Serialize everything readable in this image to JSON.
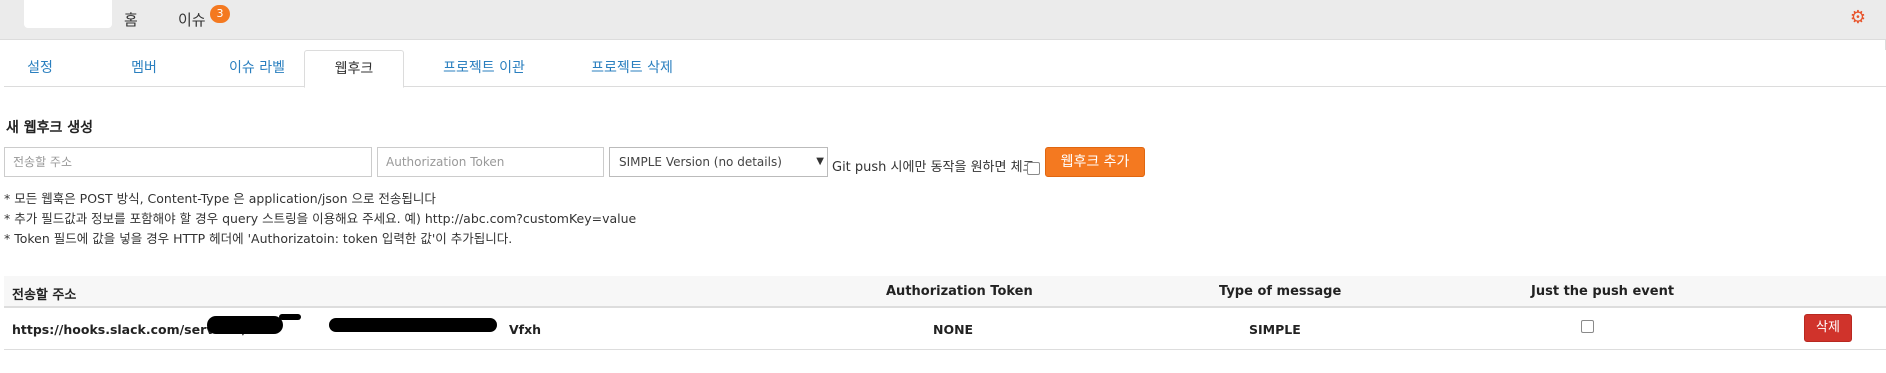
{
  "nav": {
    "home": "홈",
    "issues": "이슈",
    "issues_badge": "3",
    "settings_icon": "gear-icon"
  },
  "tabs": [
    {
      "label": "설정"
    },
    {
      "label": "멤버"
    },
    {
      "label": "이슈 라벨"
    },
    {
      "label": "웹후크",
      "active": true
    },
    {
      "label": "프로젝트 이관"
    },
    {
      "label": "프로젝트 삭제"
    }
  ],
  "form": {
    "title": "새 웹후크 생성",
    "url_placeholder": "전송할 주소",
    "token_placeholder": "Authorization Token",
    "select_value": "SIMPLE Version (no details)",
    "git_push_label": "Git push 시에만 동작을 원하면 체크",
    "git_push_checked": false,
    "add_button": "웹후크 추가"
  },
  "notes": [
    "* 모든 웹훅은 POST 방식, Content-Type 은 application/json 으로 전송됩니다",
    "* 추가 필드값과 정보를 포함해야 할 경우 query 스트링을 이용해요 주세요. 예) http://abc.com?customKey=value",
    "* Token 필드에 값을 넣을 경우 HTTP 헤더에 'Authorizatoin: token 입력한 값'이 추가됩니다."
  ],
  "table": {
    "headers": {
      "url": "전송할 주소",
      "token": "Authorization Token",
      "type": "Type of message",
      "push": "Just the push event"
    },
    "rows": [
      {
        "url_prefix": "https://hooks.slack.com/services/T9",
        "url_suffix": "Vfxh",
        "token": "NONE",
        "type": "SIMPLE",
        "push_only": false,
        "delete_label": "삭제"
      }
    ]
  },
  "colors": {
    "accent_orange": "#f47920",
    "delete_red": "#d0332b",
    "link_blue": "#2a7fbf"
  }
}
